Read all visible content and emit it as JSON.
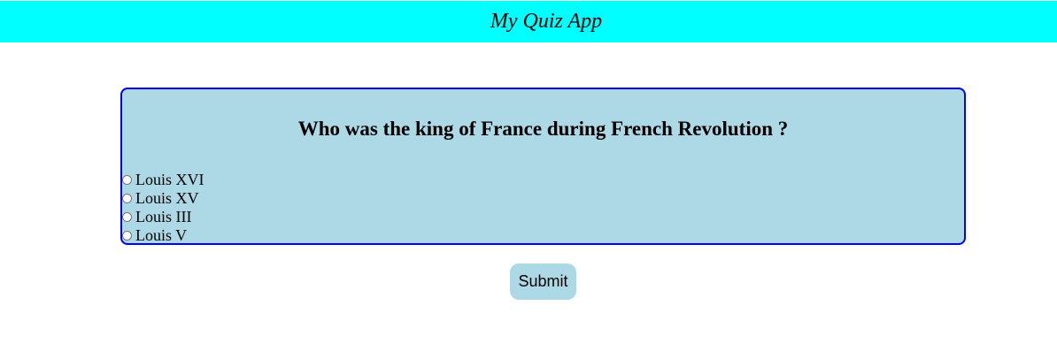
{
  "header": {
    "title": "My Quiz App",
    "background_color": "#00ffff"
  },
  "quiz": {
    "question": "Who was the king of France during French Revolution ?",
    "card_background": "#add8e6",
    "card_border": "#0000ff",
    "options": [
      {
        "label": "Louis XVI",
        "selected": false
      },
      {
        "label": "Louis XV",
        "selected": false
      },
      {
        "label": "Louis III",
        "selected": false
      },
      {
        "label": "Louis V",
        "selected": false
      }
    ]
  },
  "submit": {
    "label": "Submit",
    "background_color": "#add8e6"
  }
}
